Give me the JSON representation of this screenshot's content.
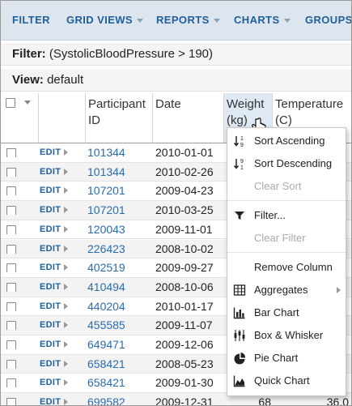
{
  "toolbar": {
    "filter": "FILTER",
    "grid_views": "GRID VIEWS",
    "reports": "REPORTS",
    "charts": "CHARTS",
    "groups": "GROUPS"
  },
  "filter_bar": {
    "label": "Filter:",
    "value": "(SystolicBloodPressure > 190)"
  },
  "view_bar": {
    "label": "View:",
    "value": "default"
  },
  "columns": {
    "participant_l1": "Participant",
    "participant_l2": "ID",
    "date": "Date",
    "weight_l1": "Weight",
    "weight_l2": "(kg)",
    "temperature_l1": "Temperature",
    "temperature_l2": "(C)"
  },
  "edit_label": "EDIT",
  "rows": [
    {
      "pid": "101344",
      "date": "2010-01-01",
      "weight": "",
      "temp": ""
    },
    {
      "pid": "101344",
      "date": "2010-02-26",
      "weight": "",
      "temp": ""
    },
    {
      "pid": "107201",
      "date": "2009-04-23",
      "weight": "",
      "temp": ""
    },
    {
      "pid": "107201",
      "date": "2010-03-25",
      "weight": "",
      "temp": ""
    },
    {
      "pid": "120043",
      "date": "2009-11-01",
      "weight": "",
      "temp": ""
    },
    {
      "pid": "226423",
      "date": "2008-10-02",
      "weight": "",
      "temp": ""
    },
    {
      "pid": "402519",
      "date": "2009-09-27",
      "weight": "",
      "temp": ""
    },
    {
      "pid": "410494",
      "date": "2008-10-06",
      "weight": "",
      "temp": ""
    },
    {
      "pid": "440204",
      "date": "2010-01-17",
      "weight": "",
      "temp": ""
    },
    {
      "pid": "455585",
      "date": "2009-11-07",
      "weight": "",
      "temp": ""
    },
    {
      "pid": "649471",
      "date": "2009-12-06",
      "weight": "",
      "temp": ""
    },
    {
      "pid": "658421",
      "date": "2008-05-23",
      "weight": "",
      "temp": ""
    },
    {
      "pid": "658421",
      "date": "2009-01-30",
      "weight": "",
      "temp": ""
    },
    {
      "pid": "699582",
      "date": "2009-12-31",
      "weight": "68",
      "temp": "36.0"
    }
  ],
  "menu": {
    "sort_asc": "Sort Ascending",
    "sort_desc": "Sort Descending",
    "clear_sort": "Clear Sort",
    "filter": "Filter...",
    "clear_filter": "Clear Filter",
    "remove_column": "Remove Column",
    "aggregates": "Aggregates",
    "bar_chart": "Bar Chart",
    "box_whisker": "Box & Whisker",
    "pie_chart": "Pie Chart",
    "quick_chart": "Quick Chart"
  }
}
